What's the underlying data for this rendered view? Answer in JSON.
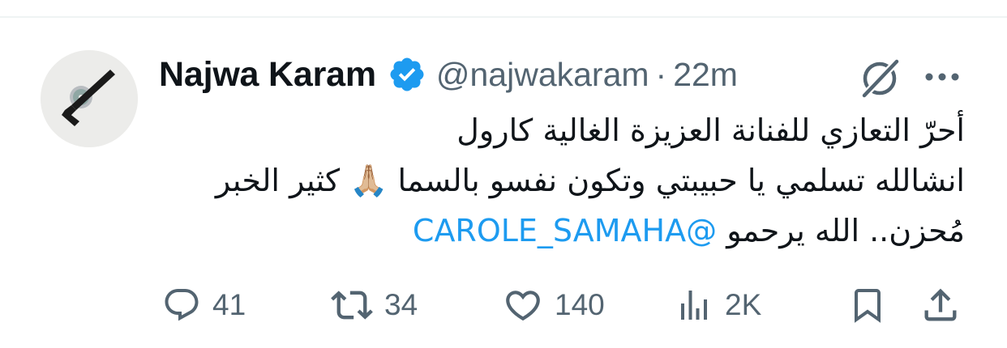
{
  "tweet": {
    "author_name": "Najwa Karam",
    "handle": "@najwakaram",
    "separator": "·",
    "time": "22m",
    "lines": [
      "أحرّ التعازي للفنانة العزيزة الغالية كارول",
      "انشالله تسلمي يا حبيبتي وتكون نفسو بالسما 🙏🏼 كثير الخبر",
      "مُحزن.. الله يرحمو"
    ],
    "mention": "@CAROLE_SAMAHA"
  },
  "actions": {
    "replies": "41",
    "reposts": "34",
    "likes": "140",
    "views": "2K"
  },
  "colors": {
    "accent": "#1d9bf0",
    "text": "#0f1419",
    "secondary": "#536471"
  },
  "icons": [
    "avatar-image",
    "verified-badge-icon",
    "grok-icon",
    "more-icon",
    "reply-icon",
    "repost-icon",
    "like-icon",
    "views-icon",
    "bookmark-icon",
    "share-icon",
    "praying-hands-emoji"
  ]
}
